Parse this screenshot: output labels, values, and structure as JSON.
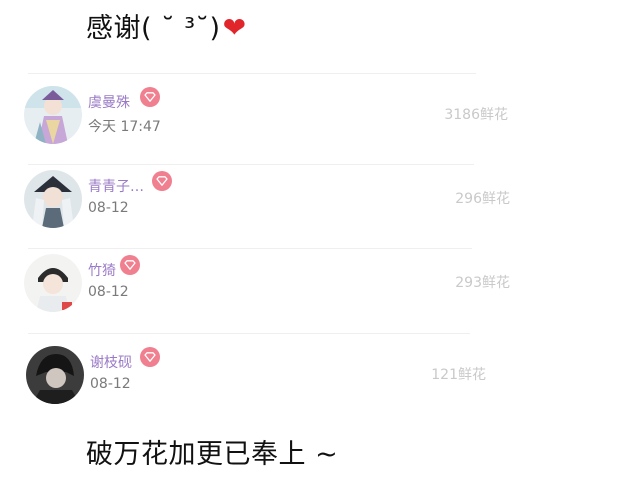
{
  "caption_top": "感谢( ˘ ³˘)",
  "heart_icon": "heart-icon",
  "caption_bottom": "破万花加更已奉上 ~",
  "colors": {
    "name": "#9a7ac6",
    "badge": "#f07f8f",
    "date": "#7a7a7a",
    "count": "#c9c9c9",
    "heart": "#e0262b"
  },
  "supporters": [
    {
      "name": "虞曼殊",
      "date": "今天 17:47",
      "flowers": "3186鲜花",
      "badge_icon": "diamond-badge-icon"
    },
    {
      "name": "青青子…",
      "date": "08-12",
      "flowers": "296鲜花",
      "badge_icon": "diamond-badge-icon"
    },
    {
      "name": "竹猗",
      "date": "08-12",
      "flowers": "293鲜花",
      "badge_icon": "diamond-badge-icon"
    },
    {
      "name": "谢枝砚",
      "date": "08-12",
      "flowers": "121鲜花",
      "badge_icon": "diamond-badge-icon"
    }
  ]
}
